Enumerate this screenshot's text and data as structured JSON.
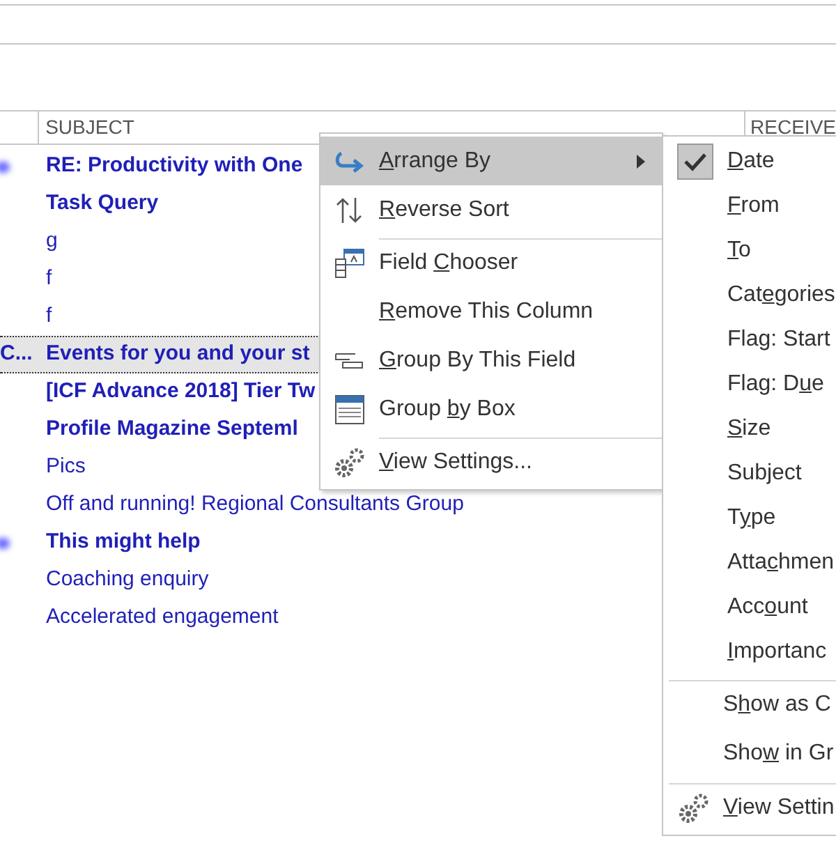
{
  "table": {
    "columns": [
      {
        "label": "SUBJECT"
      },
      {
        "label": "RECEIVE"
      }
    ],
    "rows": [
      {
        "subject": "RE: Productivity with One",
        "unread": true,
        "selected": false,
        "marker": true
      },
      {
        "subject": "Task Query",
        "unread": true,
        "selected": false,
        "marker": false
      },
      {
        "subject": "g",
        "unread": false,
        "selected": false,
        "marker": false
      },
      {
        "subject": "f",
        "unread": false,
        "selected": false,
        "marker": false
      },
      {
        "subject": "f",
        "unread": false,
        "selected": false,
        "marker": false
      },
      {
        "column_1": "C...",
        "subject": "Events for you and your st",
        "unread": true,
        "selected": true,
        "marker": false
      },
      {
        "subject": "[ICF Advance 2018] Tier Tw",
        "unread": true,
        "selected": false,
        "marker": false
      },
      {
        "subject": "Profile Magazine Septeml",
        "unread": true,
        "selected": false,
        "marker": false
      },
      {
        "subject": "Pics",
        "unread": false,
        "selected": false,
        "marker": false
      },
      {
        "subject": "Off and running! Regional Consultants Group",
        "unread": false,
        "selected": false,
        "marker": false
      },
      {
        "subject": "This might help",
        "unread": true,
        "selected": false,
        "marker": true
      },
      {
        "subject": "Coaching enquiry",
        "unread": false,
        "selected": false,
        "marker": false
      },
      {
        "subject": "Accelerated engagement",
        "unread": false,
        "selected": false,
        "marker": false
      }
    ]
  },
  "context_menu": {
    "items": [
      {
        "label": {
          "key": "A",
          "after": "rrange By"
        },
        "selected": true,
        "submenu": true,
        "separator_before": false
      },
      {
        "label": {
          "key": "R",
          "after": "everse Sort"
        },
        "selected": false,
        "submenu": false,
        "separator_before": false
      },
      {
        "label": {
          "before": "Field ",
          "key": "C",
          "after": "hooser"
        },
        "selected": false,
        "submenu": false,
        "separator_before": true
      },
      {
        "label": {
          "key": "R",
          "after": "emove This Column"
        },
        "selected": false,
        "submenu": false,
        "separator_before": false
      },
      {
        "label": {
          "key": "G",
          "after": "roup By This Field"
        },
        "selected": false,
        "submenu": false,
        "separator_before": false
      },
      {
        "label": {
          "before": "Group ",
          "key": "b",
          "after": "y Box"
        },
        "selected": false,
        "submenu": false,
        "separator_before": false
      },
      {
        "label": {
          "key": "V",
          "after": "iew Settings..."
        },
        "selected": false,
        "submenu": false,
        "separator_before": true
      }
    ]
  },
  "submenu": {
    "items": [
      {
        "kind": "option",
        "label": {
          "key": "D",
          "after": "ate"
        },
        "checked": true,
        "separator_before": false
      },
      {
        "kind": "option",
        "label": {
          "key": "F",
          "after": "rom"
        },
        "checked": false,
        "separator_before": false
      },
      {
        "kind": "option",
        "label": {
          "key": "T",
          "after": "o"
        },
        "checked": false,
        "separator_before": false
      },
      {
        "kind": "option",
        "label": {
          "before": "Cat",
          "key": "e",
          "after": "gories"
        },
        "checked": false,
        "separator_before": false
      },
      {
        "kind": "option",
        "label": {
          "before": "Fla",
          "key": "g",
          "after": ": Start"
        },
        "checked": false,
        "separator_before": false
      },
      {
        "kind": "option",
        "label": {
          "before": "Flag: D",
          "key": "u",
          "after": "e"
        },
        "checked": false,
        "separator_before": false
      },
      {
        "kind": "option",
        "label": {
          "key": "S",
          "after": "ize"
        },
        "checked": false,
        "separator_before": false
      },
      {
        "kind": "option",
        "label": {
          "before": "Sub",
          "key": "j",
          "after": "ect"
        },
        "checked": false,
        "separator_before": false
      },
      {
        "kind": "option",
        "label": {
          "before": "T",
          "key": "y",
          "after": "pe"
        },
        "checked": false,
        "separator_before": false
      },
      {
        "kind": "option",
        "label": {
          "before": "Atta",
          "key": "c",
          "after": "hmen"
        },
        "checked": false,
        "separator_before": false
      },
      {
        "kind": "option",
        "label": {
          "before": "Acc",
          "key": "o",
          "after": "unt"
        },
        "checked": false,
        "separator_before": false
      },
      {
        "kind": "option",
        "label": {
          "key": "I",
          "after": "mportanc"
        },
        "checked": false,
        "separator_before": false
      },
      {
        "kind": "toggle",
        "label": {
          "before": "S",
          "key": "h",
          "after": "ow as C"
        },
        "checked": false,
        "separator_before": true
      },
      {
        "kind": "toggle",
        "label": {
          "before": "Sho",
          "key": "w",
          "after": " in Gr"
        },
        "checked": false,
        "separator_before": false
      },
      {
        "kind": "command",
        "label": {
          "key": "V",
          "after": "iew Settin"
        },
        "separator_before": true
      }
    ]
  }
}
